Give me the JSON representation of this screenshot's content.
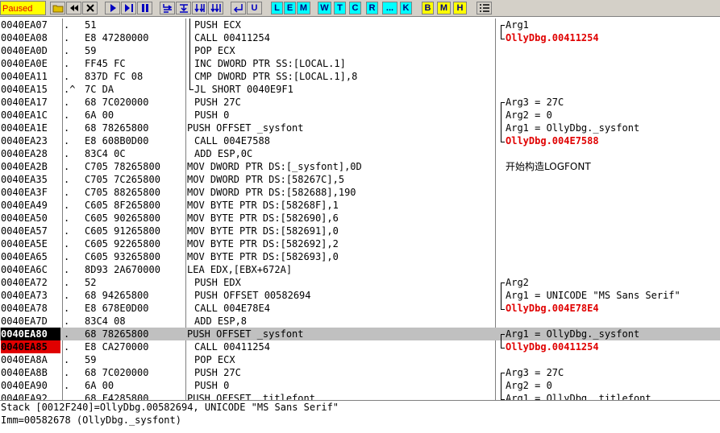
{
  "toolbar": {
    "status": "Paused",
    "letter_buttons": [
      "L",
      "E",
      "M",
      "W",
      "T",
      "C",
      "R",
      "...",
      "K",
      "B",
      "M",
      "H"
    ]
  },
  "listing": [
    {
      "addr": "0040EA07",
      "mark": ".",
      "hex": "51",
      "dis": "PUSH ECX",
      "comment": "Arg1",
      "red": false
    },
    {
      "addr": "0040EA08",
      "mark": ".",
      "hex": "E8 47280000",
      "dis": "CALL 00411254",
      "comment": "OllyDbg.00411254",
      "red": true
    },
    {
      "addr": "0040EA0D",
      "mark": ".",
      "hex": "59",
      "dis": "POP ECX",
      "comment": "",
      "red": false
    },
    {
      "addr": "0040EA0E",
      "mark": ".",
      "hex": "FF45 FC",
      "dis": "INC DWORD PTR SS:[LOCAL.1]",
      "comment": "",
      "red": false
    },
    {
      "addr": "0040EA11",
      "mark": ".",
      "hex": "837D FC 08",
      "dis": "CMP DWORD PTR SS:[LOCAL.1],8",
      "comment": "",
      "red": false
    },
    {
      "addr": "0040EA15",
      "mark": ".^",
      "hex": "7C DA",
      "dis": "JL SHORT 0040E9F1",
      "comment": "",
      "red": false
    },
    {
      "addr": "0040EA17",
      "mark": ".",
      "hex": "68 7C020000",
      "dis": "PUSH 27C",
      "comment": "Arg3 = 27C",
      "red": false
    },
    {
      "addr": "0040EA1C",
      "mark": ".",
      "hex": "6A 00",
      "dis": "PUSH 0",
      "comment": "Arg2 = 0",
      "red": false
    },
    {
      "addr": "0040EA1E",
      "mark": ".",
      "hex": "68 78265800",
      "dis": "PUSH OFFSET _sysfont",
      "comment": "Arg1 = OllyDbg._sysfont",
      "red": false
    },
    {
      "addr": "0040EA23",
      "mark": ".",
      "hex": "E8 608B0D00",
      "dis": "CALL 004E7588",
      "comment": "OllyDbg.004E7588",
      "red": true
    },
    {
      "addr": "0040EA28",
      "mark": ".",
      "hex": "83C4 0C",
      "dis": "ADD ESP,0C",
      "comment": "",
      "red": false
    },
    {
      "addr": "0040EA2B",
      "mark": ".",
      "hex": "C705 78265800",
      "dis": "MOV DWORD PTR DS:[_sysfont],0D",
      "comment": "开始构造LOGFONT",
      "red": false,
      "cjk": true
    },
    {
      "addr": "0040EA35",
      "mark": ".",
      "hex": "C705 7C265800",
      "dis": "MOV DWORD PTR DS:[58267C],5",
      "comment": "",
      "red": false
    },
    {
      "addr": "0040EA3F",
      "mark": ".",
      "hex": "C705 88265800",
      "dis": "MOV DWORD PTR DS:[582688],190",
      "comment": "",
      "red": false
    },
    {
      "addr": "0040EA49",
      "mark": ".",
      "hex": "C605 8F265800",
      "dis": "MOV BYTE PTR DS:[58268F],1",
      "comment": "",
      "red": false
    },
    {
      "addr": "0040EA50",
      "mark": ".",
      "hex": "C605 90265800",
      "dis": "MOV BYTE PTR DS:[582690],6",
      "comment": "",
      "red": false
    },
    {
      "addr": "0040EA57",
      "mark": ".",
      "hex": "C605 91265800",
      "dis": "MOV BYTE PTR DS:[582691],0",
      "comment": "",
      "red": false
    },
    {
      "addr": "0040EA5E",
      "mark": ".",
      "hex": "C605 92265800",
      "dis": "MOV BYTE PTR DS:[582692],2",
      "comment": "",
      "red": false
    },
    {
      "addr": "0040EA65",
      "mark": ".",
      "hex": "C605 93265800",
      "dis": "MOV BYTE PTR DS:[582693],0",
      "comment": "",
      "red": false
    },
    {
      "addr": "0040EA6C",
      "mark": ".",
      "hex": "8D93 2A670000",
      "dis": "LEA EDX,[EBX+672A]",
      "comment": "",
      "red": false
    },
    {
      "addr": "0040EA72",
      "mark": ".",
      "hex": "52",
      "dis": "PUSH EDX",
      "comment": "Arg2",
      "red": false
    },
    {
      "addr": "0040EA73",
      "mark": ".",
      "hex": "68 94265800",
      "dis": "PUSH OFFSET 00582694",
      "comment": "Arg1 = UNICODE \"MS Sans Serif\"",
      "red": false
    },
    {
      "addr": "0040EA78",
      "mark": ".",
      "hex": "E8 678E0D00",
      "dis": "CALL 004E78E4",
      "comment": "OllyDbg.004E78E4",
      "red": true
    },
    {
      "addr": "0040EA7D",
      "mark": ".",
      "hex": "83C4 08",
      "dis": "ADD ESP,8",
      "comment": "",
      "red": false
    },
    {
      "addr": "0040EA80",
      "mark": ".",
      "hex": "68 78265800",
      "dis": "PUSH OFFSET _sysfont",
      "comment": "Arg1 = OllyDbg._sysfont",
      "red": false,
      "sel": true,
      "addrStyle": "eip"
    },
    {
      "addr": "0040EA85",
      "mark": ".",
      "hex": "E8 CA270000",
      "dis": "CALL 00411254",
      "comment": "OllyDbg.00411254",
      "red": true,
      "addrStyle": "bp"
    },
    {
      "addr": "0040EA8A",
      "mark": ".",
      "hex": "59",
      "dis": "POP ECX",
      "comment": "",
      "red": false
    },
    {
      "addr": "0040EA8B",
      "mark": ".",
      "hex": "68 7C020000",
      "dis": "PUSH 27C",
      "comment": "Arg3 = 27C",
      "red": false
    },
    {
      "addr": "0040EA90",
      "mark": ".",
      "hex": "6A 00",
      "dis": "PUSH 0",
      "comment": "Arg2 = 0",
      "red": false
    },
    {
      "addr": "0040EA92",
      "mark": ".",
      "hex": "68 F4285800",
      "dis": "PUSH OFFSET _titlefont",
      "comment": "Arg1 = OllyDbg._titlefont",
      "red": false
    }
  ],
  "info": {
    "line1": "Stack [0012F240]=OllyDbg.00582694, UNICODE \"MS Sans Serif\"",
    "line2": "Imm=00582678 (OllyDbg._sysfont)"
  }
}
